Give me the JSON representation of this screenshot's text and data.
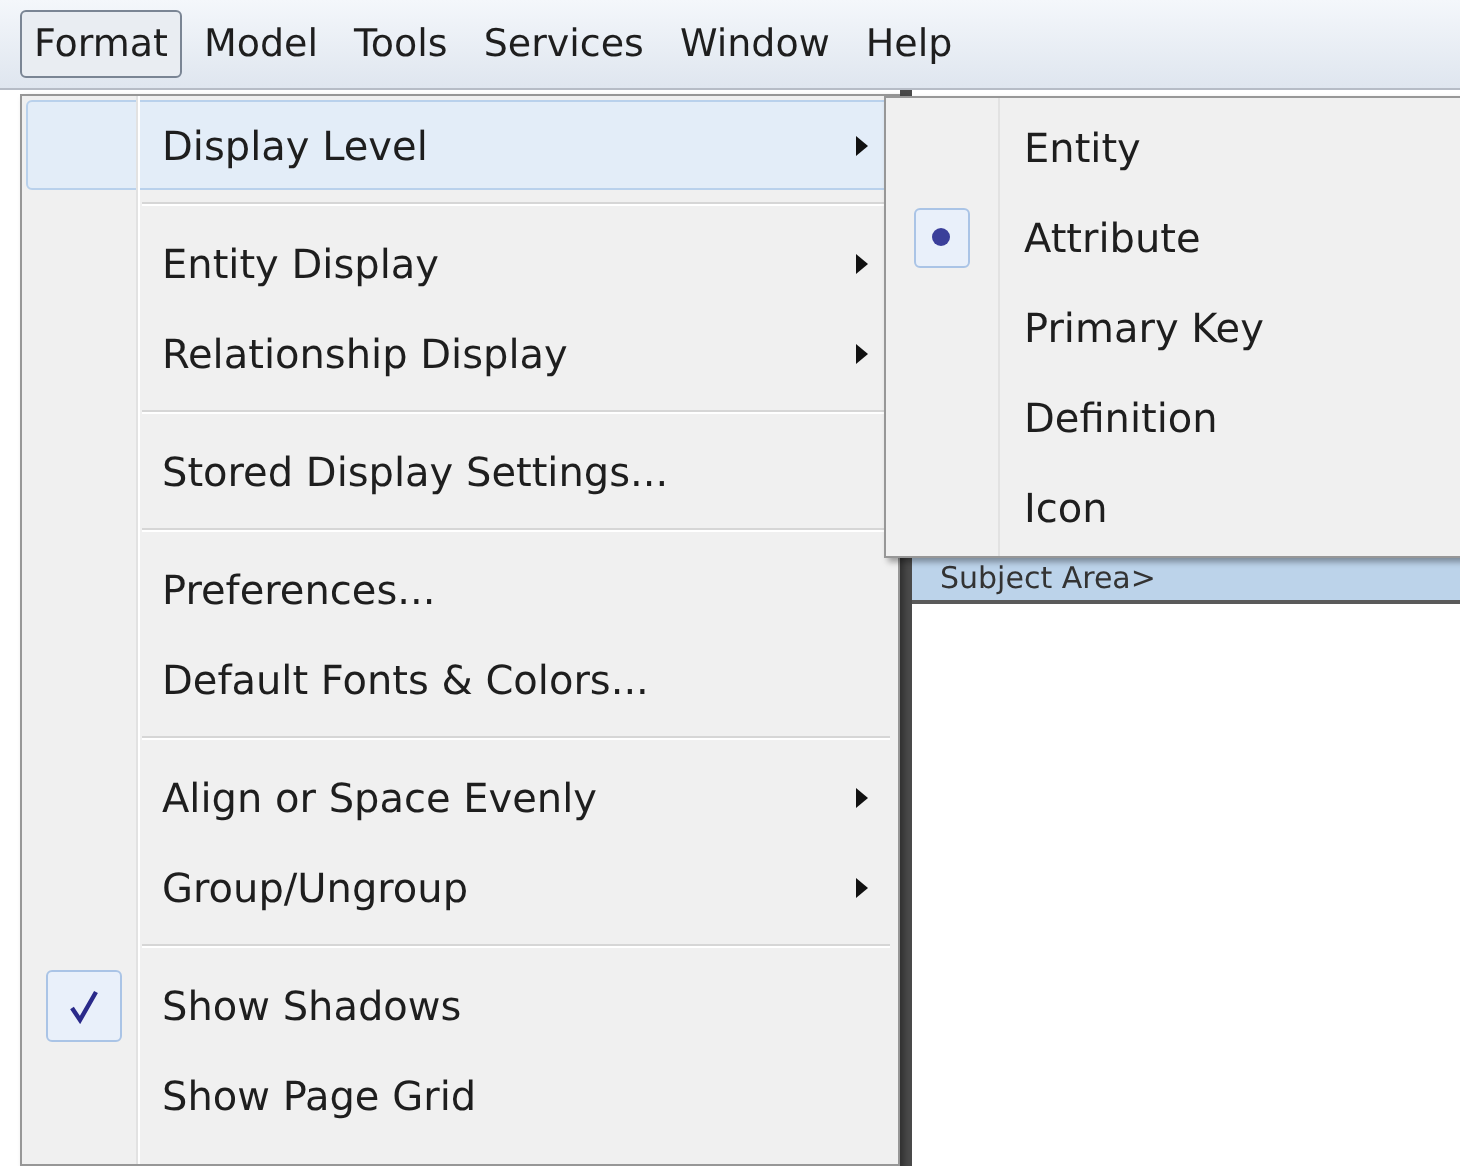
{
  "menubar": [
    {
      "label": "Format",
      "selected": true
    },
    {
      "label": "Model",
      "selected": false
    },
    {
      "label": "Tools",
      "selected": false
    },
    {
      "label": "Services",
      "selected": false
    },
    {
      "label": "Window",
      "selected": false
    },
    {
      "label": "Help",
      "selected": false
    }
  ],
  "menu": [
    {
      "kind": "item",
      "label": "Display Level",
      "submenu": true,
      "highlighted": true,
      "checked": false
    },
    {
      "kind": "separator"
    },
    {
      "kind": "item",
      "label": "Entity Display",
      "submenu": true,
      "highlighted": false,
      "checked": false
    },
    {
      "kind": "item",
      "label": "Relationship Display",
      "submenu": true,
      "highlighted": false,
      "checked": false
    },
    {
      "kind": "separator"
    },
    {
      "kind": "item",
      "label": "Stored Display Settings...",
      "submenu": false,
      "highlighted": false,
      "checked": false
    },
    {
      "kind": "separator"
    },
    {
      "kind": "item",
      "label": "Preferences...",
      "submenu": false,
      "highlighted": false,
      "checked": false
    },
    {
      "kind": "item",
      "label": "Default Fonts & Colors...",
      "submenu": false,
      "highlighted": false,
      "checked": false
    },
    {
      "kind": "separator"
    },
    {
      "kind": "item",
      "label": "Align or Space Evenly",
      "submenu": true,
      "highlighted": false,
      "checked": false
    },
    {
      "kind": "item",
      "label": "Group/Ungroup",
      "submenu": true,
      "highlighted": false,
      "checked": false
    },
    {
      "kind": "separator"
    },
    {
      "kind": "item",
      "label": "Show Shadows",
      "submenu": false,
      "highlighted": false,
      "checked": true
    },
    {
      "kind": "item",
      "label": "Show Page Grid",
      "submenu": false,
      "highlighted": false,
      "checked": false
    }
  ],
  "submenu": [
    {
      "label": "Entity",
      "selected": false
    },
    {
      "label": "Attribute",
      "selected": true
    },
    {
      "label": "Primary Key",
      "selected": false
    },
    {
      "label": "Definition",
      "selected": false
    },
    {
      "label": "Icon",
      "selected": false
    }
  ],
  "canvas": {
    "header": "Subject Area>"
  }
}
